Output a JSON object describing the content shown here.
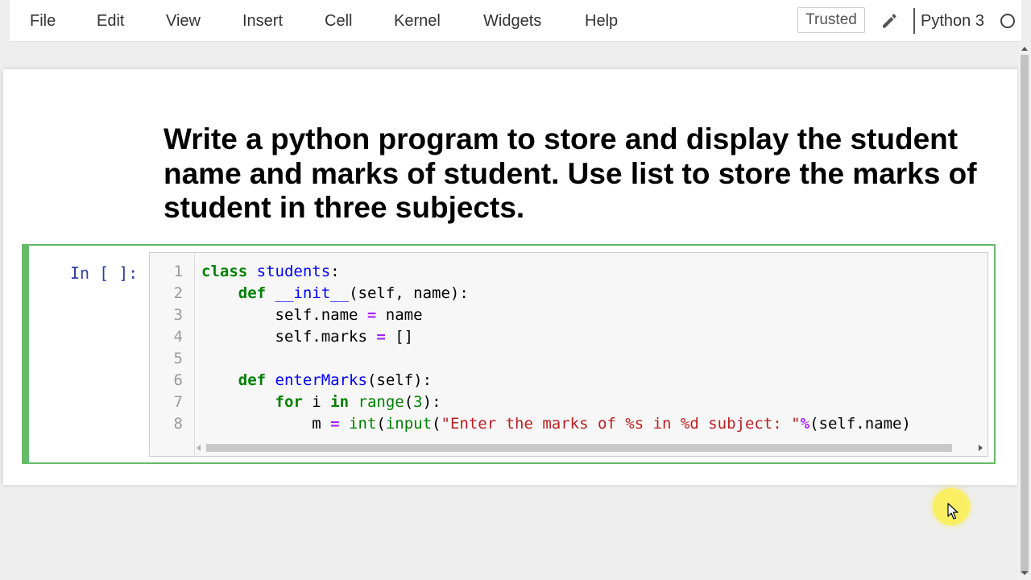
{
  "menubar": {
    "items": [
      "File",
      "Edit",
      "View",
      "Insert",
      "Cell",
      "Kernel",
      "Widgets",
      "Help"
    ],
    "trusted_label": "Trusted",
    "kernel_name": "Python 3"
  },
  "markdown_cell": {
    "text": "Write a python program to store and display the student name and marks of student. Use list to store the marks of student in three subjects."
  },
  "code_cell": {
    "prompt": "In [ ]:",
    "line_numbers": [
      "1",
      "2",
      "3",
      "4",
      "5",
      "6",
      "7",
      "8"
    ],
    "lines": [
      "class students:",
      "    def __init__(self, name):",
      "        self.name = name",
      "        self.marks = []",
      "",
      "    def enterMarks(self):",
      "        for i in range(3):",
      "            m = int(input(\"Enter the marks of %s in %d subject: \"%(self.name)"
    ]
  },
  "colors": {
    "cell_border": "#66bb6a",
    "prompt": "#303f9f",
    "keyword": "#008000",
    "definition": "#0000ff",
    "operator": "#aa22ff",
    "string": "#ba2121"
  },
  "icons": {
    "edit": "pencil-icon",
    "kernel_status": "kernel-idle-circle-icon",
    "cursor": "mouse-pointer-icon"
  }
}
